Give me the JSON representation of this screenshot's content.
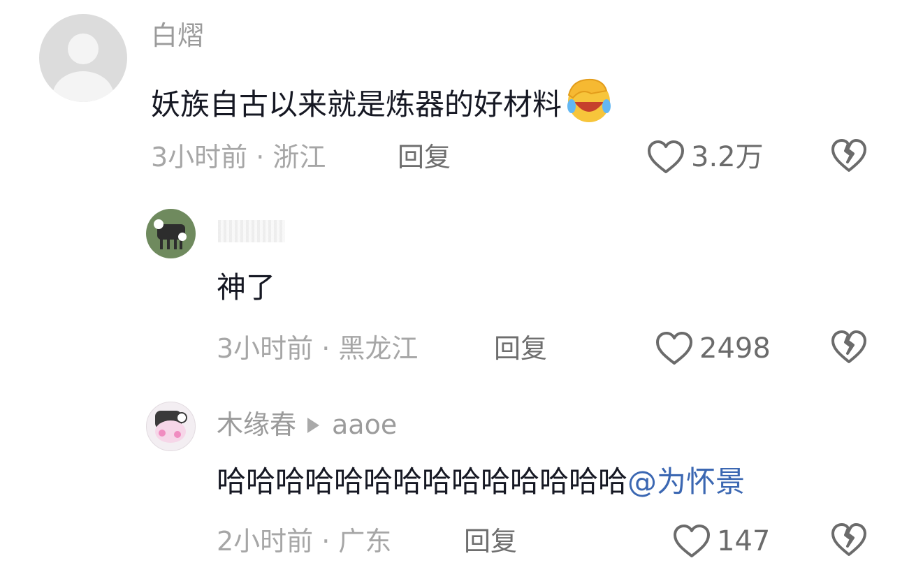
{
  "comments": [
    {
      "author": "白熠",
      "text": "妖族自古以来就是炼器的好材料",
      "emoji": "facepalm-laughing-emoji",
      "time_location": "3小时前 · 浙江",
      "reply_label": "回复",
      "likes": "3.2万"
    },
    {
      "author": "",
      "text": "神了",
      "time_location": "3小时前 · 黑龙江",
      "reply_label": "回复",
      "likes": "2498"
    },
    {
      "author": "木缘春",
      "reply_to": "aaoe",
      "text": "哈哈哈哈哈哈哈哈哈哈哈哈哈哈",
      "mention": "@为怀景",
      "time_location": "2小时前 · 广东",
      "reply_label": "回复",
      "likes": "147"
    }
  ],
  "icons": {
    "like": "heart-outline-icon",
    "dislike": "broken-heart-icon"
  },
  "colors": {
    "mention": "#3b67b2",
    "meta": "#a6a6a6",
    "text": "#161823"
  }
}
